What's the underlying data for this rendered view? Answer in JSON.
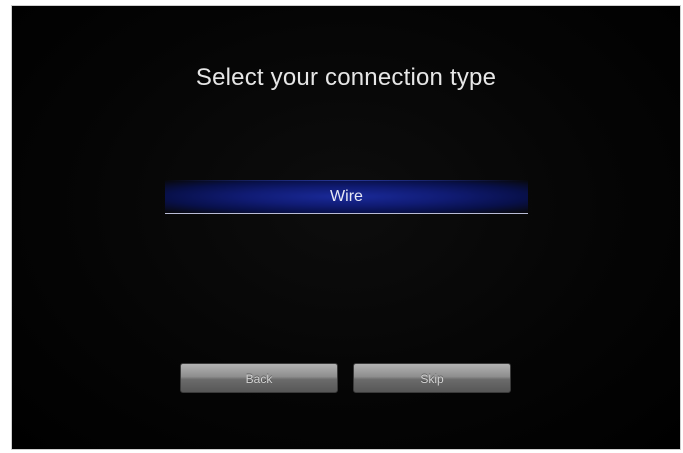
{
  "screen": {
    "title": "Select your connection type"
  },
  "connection_options": [
    {
      "label": "Wire",
      "selected": true
    }
  ],
  "buttons": {
    "back_label": "Back",
    "skip_label": "Skip"
  },
  "colors": {
    "background": "#000000",
    "selection_highlight": "#101b73",
    "button": "#8e8e8e",
    "text": "#e6e6e6"
  }
}
